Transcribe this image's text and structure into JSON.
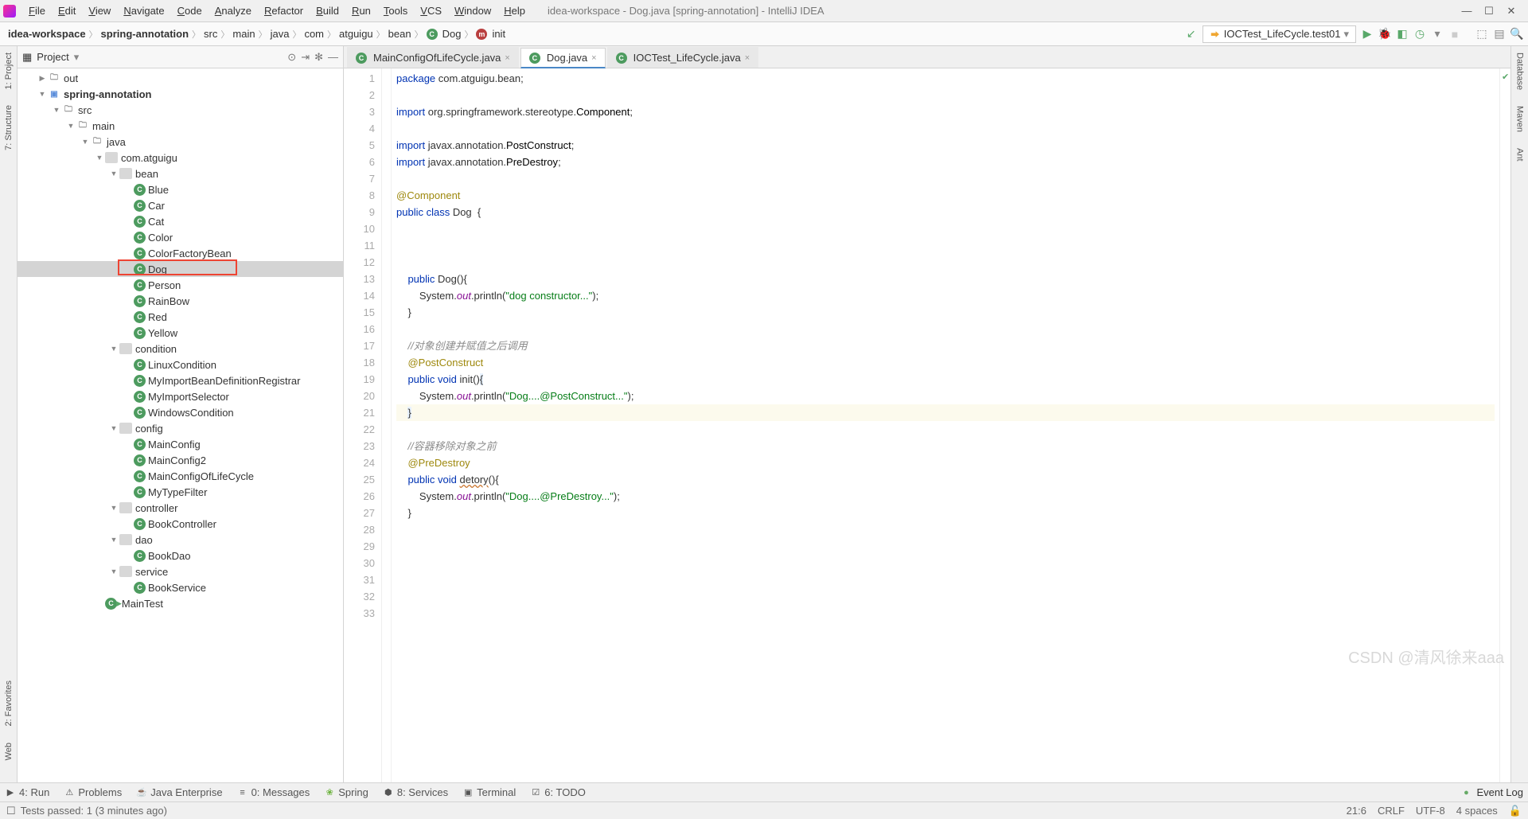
{
  "window": {
    "title": "idea-workspace - Dog.java [spring-annotation] - IntelliJ IDEA"
  },
  "menubar": [
    "File",
    "Edit",
    "View",
    "Navigate",
    "Code",
    "Analyze",
    "Refactor",
    "Build",
    "Run",
    "Tools",
    "VCS",
    "Window",
    "Help"
  ],
  "breadcrumbs": [
    "idea-workspace",
    "spring-annotation",
    "src",
    "main",
    "java",
    "com",
    "atguigu",
    "bean",
    "Dog",
    "init"
  ],
  "run_config": "IOCTest_LifeCycle.test01",
  "left_rail": [
    "1: Project",
    "7: Structure",
    "2: Favorites",
    "Web"
  ],
  "right_rail": [
    "Database",
    "Maven",
    "Ant"
  ],
  "project": {
    "title": "Project",
    "tree": [
      {
        "d": 1,
        "a": "▶",
        "i": "folder",
        "t": "out"
      },
      {
        "d": 1,
        "a": "▼",
        "i": "mod",
        "t": "spring-annotation",
        "bold": true
      },
      {
        "d": 2,
        "a": "▼",
        "i": "folder",
        "t": "src"
      },
      {
        "d": 3,
        "a": "▼",
        "i": "folder",
        "t": "main"
      },
      {
        "d": 4,
        "a": "▼",
        "i": "folder",
        "t": "java"
      },
      {
        "d": 5,
        "a": "▼",
        "i": "pkg",
        "t": "com.atguigu"
      },
      {
        "d": 6,
        "a": "▼",
        "i": "pkg",
        "t": "bean"
      },
      {
        "d": 7,
        "a": "",
        "i": "class",
        "t": "Blue"
      },
      {
        "d": 7,
        "a": "",
        "i": "class",
        "t": "Car"
      },
      {
        "d": 7,
        "a": "",
        "i": "class",
        "t": "Cat"
      },
      {
        "d": 7,
        "a": "",
        "i": "class",
        "t": "Color"
      },
      {
        "d": 7,
        "a": "",
        "i": "class",
        "t": "ColorFactoryBean"
      },
      {
        "d": 7,
        "a": "",
        "i": "class",
        "t": "Dog",
        "sel": true,
        "box": true
      },
      {
        "d": 7,
        "a": "",
        "i": "class",
        "t": "Person"
      },
      {
        "d": 7,
        "a": "",
        "i": "class",
        "t": "RainBow"
      },
      {
        "d": 7,
        "a": "",
        "i": "class",
        "t": "Red"
      },
      {
        "d": 7,
        "a": "",
        "i": "class",
        "t": "Yellow"
      },
      {
        "d": 6,
        "a": "▼",
        "i": "pkg",
        "t": "condition"
      },
      {
        "d": 7,
        "a": "",
        "i": "class",
        "t": "LinuxCondition"
      },
      {
        "d": 7,
        "a": "",
        "i": "class",
        "t": "MyImportBeanDefinitionRegistrar"
      },
      {
        "d": 7,
        "a": "",
        "i": "class",
        "t": "MyImportSelector"
      },
      {
        "d": 7,
        "a": "",
        "i": "class",
        "t": "WindowsCondition"
      },
      {
        "d": 6,
        "a": "▼",
        "i": "pkg",
        "t": "config"
      },
      {
        "d": 7,
        "a": "",
        "i": "class",
        "t": "MainConfig"
      },
      {
        "d": 7,
        "a": "",
        "i": "class",
        "t": "MainConfig2"
      },
      {
        "d": 7,
        "a": "",
        "i": "class",
        "t": "MainConfigOfLifeCycle"
      },
      {
        "d": 7,
        "a": "",
        "i": "class",
        "t": "MyTypeFilter"
      },
      {
        "d": 6,
        "a": "▼",
        "i": "pkg",
        "t": "controller"
      },
      {
        "d": 7,
        "a": "",
        "i": "class",
        "t": "BookController"
      },
      {
        "d": 6,
        "a": "▼",
        "i": "pkg",
        "t": "dao"
      },
      {
        "d": 7,
        "a": "",
        "i": "class",
        "t": "BookDao"
      },
      {
        "d": 6,
        "a": "▼",
        "i": "pkg",
        "t": "service"
      },
      {
        "d": 7,
        "a": "",
        "i": "class",
        "t": "BookService"
      },
      {
        "d": 5,
        "a": "",
        "i": "class",
        "t": "MainTest",
        "run": true
      }
    ]
  },
  "tabs": [
    {
      "label": "MainConfigOfLifeCycle.java",
      "ico": "class",
      "act": false
    },
    {
      "label": "Dog.java",
      "ico": "class",
      "act": true
    },
    {
      "label": "IOCTest_LifeCycle.java",
      "ico": "class",
      "act": false
    }
  ],
  "code_lines": [
    {
      "n": 1,
      "h": "<span class='kw'>package</span> com.atguigu.bean;"
    },
    {
      "n": 2,
      "h": ""
    },
    {
      "n": 3,
      "h": "<span class='kw'>import</span> org.springframework.stereotype.<span class='cls'>Component</span>;"
    },
    {
      "n": 4,
      "h": ""
    },
    {
      "n": 5,
      "h": "<span class='kw'>import</span> javax.annotation.<span class='cls'>PostConstruct</span>;"
    },
    {
      "n": 6,
      "h": "<span class='kw'>import</span> javax.annotation.<span class='cls'>PreDestroy</span>;"
    },
    {
      "n": 7,
      "h": ""
    },
    {
      "n": 8,
      "h": "<span class='ann'>@Component</span>"
    },
    {
      "n": 9,
      "h": "<span class='kw'>public class</span> Dog  {"
    },
    {
      "n": 10,
      "h": ""
    },
    {
      "n": 11,
      "h": ""
    },
    {
      "n": 12,
      "h": ""
    },
    {
      "n": 13,
      "h": "    <span class='kw'>public</span> Dog(){"
    },
    {
      "n": 14,
      "h": "        System.<span class='fld'>out</span>.println(<span class='str'>\"dog constructor...\"</span>);"
    },
    {
      "n": 15,
      "h": "    }"
    },
    {
      "n": 16,
      "h": ""
    },
    {
      "n": 17,
      "h": "    <span class='com'>//对象创建并赋值之后调用</span>"
    },
    {
      "n": 18,
      "h": "    <span class='ann'>@PostConstruct</span>"
    },
    {
      "n": 19,
      "h": "    <span class='kw'>public void</span> init()<span class='mrk'>{</span>"
    },
    {
      "n": 20,
      "h": "        System.<span class='fld'>out</span>.println(<span class='str'>\"Dog....@PostConstruct...\"</span>);"
    },
    {
      "n": 21,
      "h": "    <span class='mrk'>}</span>",
      "hl": true
    },
    {
      "n": 22,
      "h": ""
    },
    {
      "n": 23,
      "h": "    <span class='com'>//容器移除对象之前</span>"
    },
    {
      "n": 24,
      "h": "    <span class='ann'>@PreDestroy</span>"
    },
    {
      "n": 25,
      "h": "    <span class='kw'>public void</span> <span class='warn'>detory</span>(){"
    },
    {
      "n": 26,
      "h": "        System.<span class='fld'>out</span>.println(<span class='str'>\"Dog....@PreDestroy...\"</span>);"
    },
    {
      "n": 27,
      "h": "    }"
    },
    {
      "n": 28,
      "h": ""
    },
    {
      "n": 29,
      "h": ""
    },
    {
      "n": 30,
      "h": ""
    },
    {
      "n": 31,
      "h": ""
    },
    {
      "n": 32,
      "h": ""
    },
    {
      "n": 33,
      "h": ""
    }
  ],
  "bottom_tabs": [
    "4: Run",
    "Problems",
    "Java Enterprise",
    "0: Messages",
    "Spring",
    "8: Services",
    "Terminal",
    "6: TODO"
  ],
  "event_log": "Event Log",
  "status": {
    "msg": "Tests passed: 1 (3 minutes ago)",
    "pos": "21:6",
    "enc": "CRLF",
    "charset": "UTF-8",
    "spaces": "4 spaces"
  },
  "watermark": "CSDN @清风徐来aaa"
}
